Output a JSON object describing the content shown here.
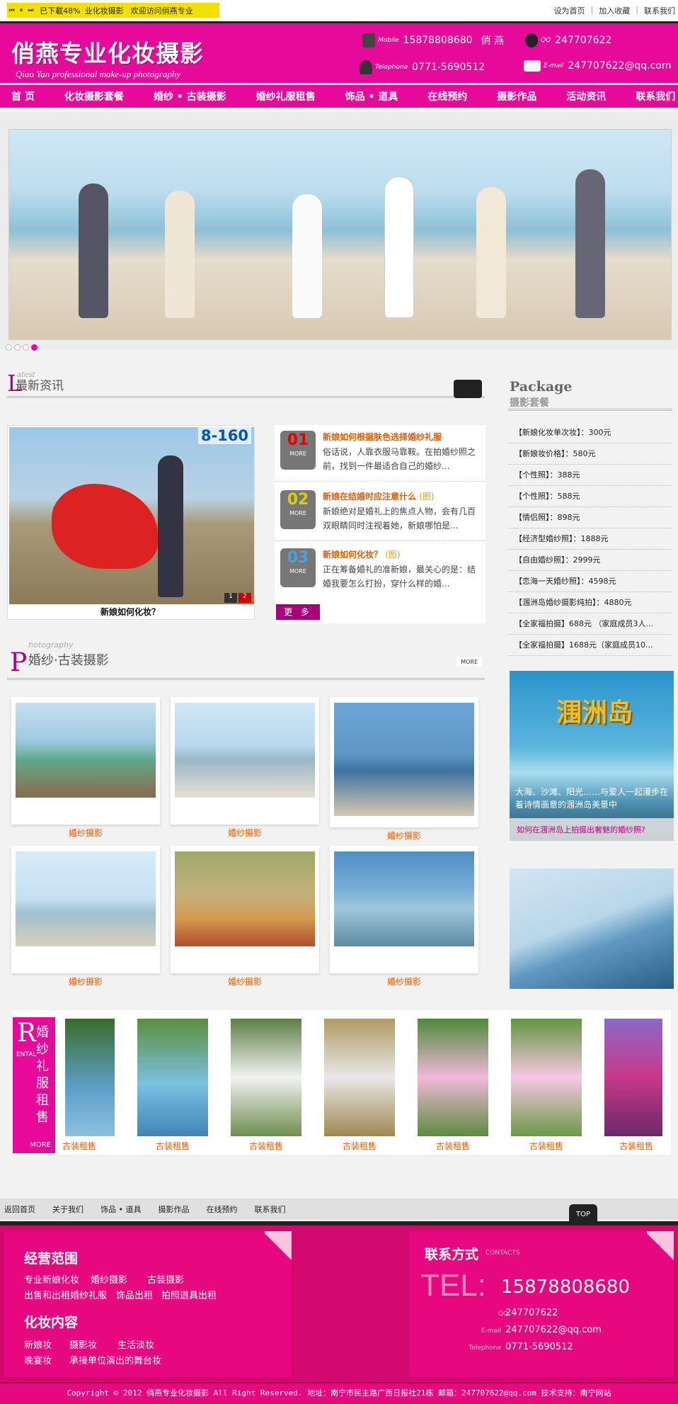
{
  "topbar": {
    "player_progress": "已下載48%",
    "player_link": "业化妆摄影",
    "player_msg": "欢迎访问俏燕专业",
    "links": [
      "设为首页",
      "加入收藏",
      "联系我们"
    ]
  },
  "header": {
    "logo_cn": "俏燕专业化妆摄影",
    "logo_en": "Qiao Yan  professional make-up photography",
    "mobile_label": "Mobile",
    "mobile": "15878808680",
    "mobile_name": "俏 燕",
    "qq_label": "QQ",
    "qq": "247707622",
    "tel_label": "Telephone",
    "tel": "0771-5690512",
    "email_label": "E-mail",
    "email": "247707622@qq.com"
  },
  "nav": [
    "首 页",
    "化妆摄影套餐",
    "婚纱 • 古装摄影",
    "婚纱礼服租售",
    "饰品 • 道具",
    "在线预约",
    "摄影作品",
    "活动资讯",
    "联系我们"
  ],
  "news": {
    "small": "atest",
    "big": "L",
    "title": "最新资讯",
    "photo_num": "8-160",
    "photo_caption": "新娘如何化妆？",
    "pager": [
      "1",
      "2"
    ],
    "items": [
      {
        "num": "01",
        "more": "MORE",
        "title": "新娘如何根据肤色选择婚纱礼服",
        "tag": "",
        "desc": "俗话说，人靠衣服马靠鞍。在拍婚纱照之前，找到一件最适合自己的婚纱..."
      },
      {
        "num": "02",
        "more": "MORE",
        "title": "新娘在结婚时应注意什么",
        "tag": "(图)",
        "desc": "新娘绝对是婚礼上的焦点人物，会有几百双眼睛同时注视着她，新娘哪怕是..."
      },
      {
        "num": "03",
        "more": "MORE",
        "title": "新娘如何化妆？",
        "tag": "(图)",
        "desc": "正在筹备婚礼的准新娘，最关心的是：结婚我要怎么打扮，穿什么样的婚..."
      }
    ],
    "more_btn": "更 多"
  },
  "package": {
    "en": "Package",
    "cn": "摄影套餐",
    "items": [
      "【新娘化妆单次妆】：300元",
      "【新娘妆价格】：580元",
      "【个性照】：388元",
      "【个性照】：588元",
      "【情侣照】：898元",
      "【经济型婚纱照】：1888元",
      "【自由婚纱照】：2999元",
      "【恋海一天婚纱照】：4598元",
      "【涠洲岛婚纱摄影纯拍】：4880元",
      "【全家福拍摄】688元 （家庭成员3人...",
      "【全家福拍摄】1688元（家庭成员10..."
    ]
  },
  "island": {
    "title": "涠洲岛",
    "desc": "大海、沙滩、阳光……与爱人一起漫步在着诗情画意的涠洲岛美景中",
    "caption": "如何在涠洲岛上拍摄出奢魅的婚纱照?"
  },
  "wedding": {
    "small": "hotography",
    "big": "P",
    "title": "婚纱·古装摄影",
    "more": "MORE",
    "labels": [
      "婚纱摄影",
      "婚纱摄影",
      "婚纱摄影",
      "婚纱摄影",
      "婚纱摄影",
      "婚纱摄影"
    ]
  },
  "rental": {
    "r": "R",
    "v": "婚纱礼服租售",
    "e": "ENTAL",
    "more": "MORE",
    "labels": [
      "古装租售",
      "古装租售",
      "古装租售",
      "古装租售",
      "古装租售",
      "古装租售",
      "古装租售"
    ]
  },
  "footnav": [
    "返回首页",
    "关于我们",
    "饰品 • 道具",
    "摄影作品",
    "在线预约",
    "联系我们"
  ],
  "top_btn": "TOP",
  "footer": {
    "scope_title": "经营范围",
    "scope_items": [
      "专业新娘化妆",
      "婚纱摄影",
      "古装摄影",
      "出售和出租婚纱礼服",
      "饰品出租",
      "拍照道具出租"
    ],
    "makeup_title": "化妆内容",
    "makeup_items": [
      "新娘妆",
      "摄影妆",
      "生活淡妆",
      "晚宴妆",
      "承接单位演出的舞台妆"
    ],
    "contact_title": "联系方式",
    "contact_en": "CONTACTS",
    "tel_big": "TEL:",
    "tel_num": "15878808680",
    "qq_label": "QQ",
    "qq": "247707622",
    "email_label": "E-mail",
    "email": "247707622@qq.com",
    "phone_label": "Telephone",
    "phone": "0771-5690512"
  },
  "copyright": "Copyright © 2012  俏燕专业化妆摄影 All Right Reserved. 地址：南宁市民主路广西日报社21栋    邮箱：247707622@qq.com    技术支持：南宁网站"
}
